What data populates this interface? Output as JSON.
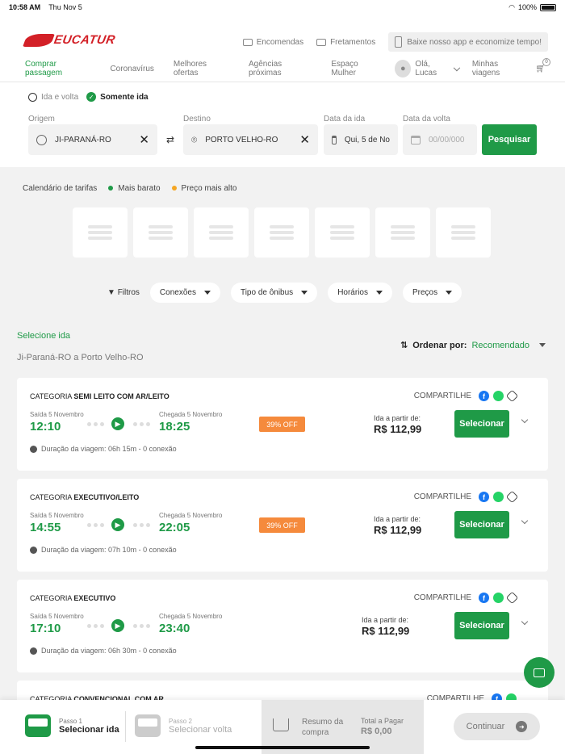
{
  "status": {
    "time": "10:58 AM",
    "date": "Thu Nov 5",
    "battery": "100%"
  },
  "header": {
    "logo": "EUCATUR",
    "links": {
      "encomendas": "Encomendas",
      "fretamentos": "Fretamentos",
      "app": "Baixe nosso app e economize tempo!"
    },
    "nav": [
      "Comprar passagem",
      "Coronavírus",
      "Melhores ofertas",
      "Agências próximas",
      "Espaço Mulher"
    ],
    "user": "Olá, Lucas",
    "my_trips": "Minhas viagens",
    "cart_count": "0"
  },
  "search": {
    "round_trip": "Ida e volta",
    "one_way": "Somente ida",
    "origin_label": "Origem",
    "origin_value": "JI-PARANÁ-RO",
    "dest_label": "Destino",
    "dest_value": "PORTO VELHO-RO",
    "depart_label": "Data da ida",
    "depart_value": "Qui, 5 de No",
    "return_label": "Data da volta",
    "return_placeholder": "00/00/000",
    "button": "Pesquisar"
  },
  "fares": {
    "title": "Calendário de tarifas",
    "cheapest": "Mais barato",
    "highest": "Preço mais alto",
    "cheapest_color": "#1f9a47",
    "highest_color": "#f5a623"
  },
  "filters": {
    "label": "Filtros",
    "items": [
      "Conexões",
      "Tipo de ônibus",
      "Horários",
      "Preços"
    ]
  },
  "results": {
    "title": "Selecione ida",
    "route": "Ji-Paraná-RO a Porto Velho-RO",
    "order_label": "Ordenar por:",
    "order_value": "Recomendado",
    "share": "COMPARTILHE",
    "dep_prefix": "Saída 5 Novembro",
    "arr_prefix": "Chegada 5 Novembro",
    "from_label": "Ida a partir de:",
    "select": "Selecionar",
    "category_prefix": "CATEGORIA",
    "trips": [
      {
        "category": "SEMI LEITO COM AR/LEITO",
        "dep": "12:10",
        "arr": "18:25",
        "discount": "39% OFF",
        "price": "R$ 112,99",
        "duration": "Duração da viagem: 06h 15m - 0 conexão"
      },
      {
        "category": "EXECUTIVO/LEITO",
        "dep": "14:55",
        "arr": "22:05",
        "discount": "39% OFF",
        "price": "R$ 112,99",
        "duration": "Duração da viagem: 07h 10m - 0 conexão"
      },
      {
        "category": "EXECUTIVO",
        "dep": "17:10",
        "arr": "23:40",
        "discount": "",
        "price": "R$ 112,99",
        "duration": "Duração da viagem: 06h 30m - 0 conexão"
      },
      {
        "category": "CONVENCIONAL COM AR",
        "dep": "",
        "arr": "",
        "discount": "",
        "price": "",
        "duration": ""
      }
    ]
  },
  "bottom": {
    "step1_label": "Passo 1",
    "step1_value": "Selecionar ida",
    "step2_label": "Passo 2",
    "step2_value": "Selecionar volta",
    "summary": "Resumo da compra",
    "total_label": "Total a Pagar",
    "total_value": "R$ 0,00",
    "continue": "Continuar"
  },
  "colors": {
    "brand": "#d32027",
    "accent": "#1f9a47",
    "discount": "#f58a3c"
  }
}
